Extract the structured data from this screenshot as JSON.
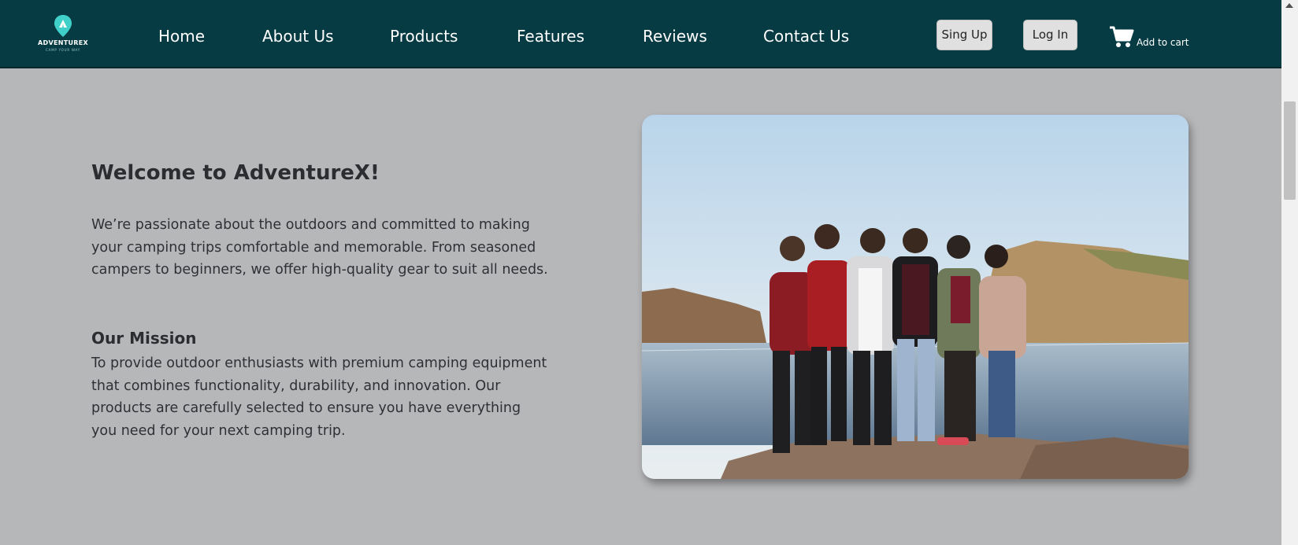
{
  "brand": {
    "name": "ADVENTUREX",
    "tagline": "CAMP YOUR WAY"
  },
  "nav": {
    "links": [
      "Home",
      "About Us",
      "Products",
      "Features",
      "Reviews",
      "Contact Us"
    ]
  },
  "auth": {
    "signup_label": "Sing Up",
    "login_label": "Log In"
  },
  "cart": {
    "label": "Add to cart",
    "icon": "cart-icon"
  },
  "about": {
    "title": "Welcome to AdventureX!",
    "intro": "We’re passionate about the outdoors and committed to making your camping trips comfortable and memorable. From seasoned campers to beginners, we offer high-quality gear to suit all needs.",
    "mission_title": "Our Mission",
    "mission_text": "To provide outdoor enthusiasts with premium camping equipment that combines functionality, durability, and innovation. Our products are carefully selected to ensure you have everything you need for your next camping trip."
  },
  "colors": {
    "navbar": "#063b43",
    "page_background": "#b6b7b9",
    "logo_accent": "#3fd0c9"
  }
}
